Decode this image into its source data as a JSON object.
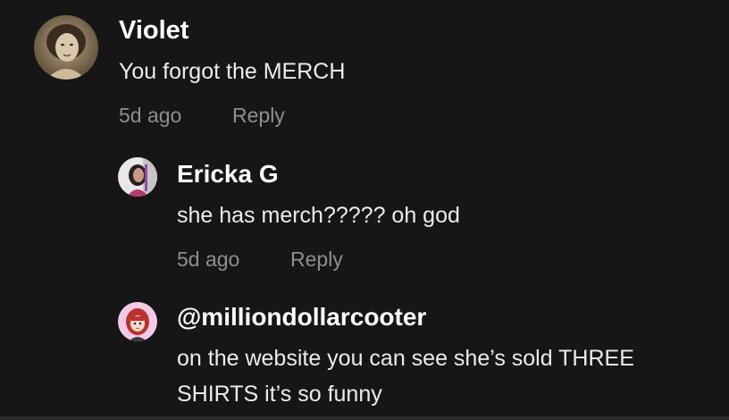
{
  "comments": [
    {
      "username": "Violet",
      "text": "You forgot the MERCH",
      "timestamp": "5d ago",
      "reply_label": "Reply",
      "avatar_icon": "vintage-portrait-avatar"
    },
    {
      "username": "Ericka G",
      "text": "she has merch????? oh god",
      "timestamp": "5d ago",
      "reply_label": "Reply",
      "avatar_icon": "photo-avatar"
    },
    {
      "username": "@milliondollarcooter",
      "text": "on the website you can see she’s sold THREE SHIRTS it’s so funny",
      "avatar_icon": "cartoon-redhead-avatar"
    }
  ],
  "colors": {
    "background": "#161616",
    "username": "#ffffff",
    "text": "#ececec",
    "meta": "#8e8e8e"
  }
}
